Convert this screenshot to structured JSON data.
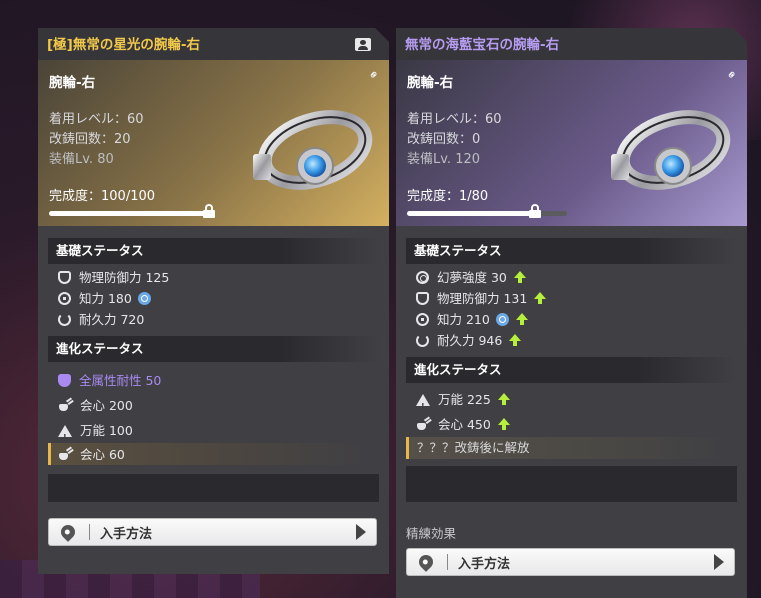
{
  "left_panel": {
    "title": "[極]無常の星光の腕輪-右",
    "slot": "腕輪-右",
    "meta": [
      "着用レベル：60",
      "改鋳回数：20",
      "装備Lv. 80"
    ],
    "completion": "完成度：100/100",
    "completion_fraction": 1.0,
    "base_header": "基礎ステータス",
    "base_stats": [
      {
        "icon": "shield-icon",
        "text": "物理防御力 125"
      },
      {
        "icon": "intellect-icon",
        "text": "知力 180"
      },
      {
        "icon": "durability-icon",
        "text": "耐久力 720"
      }
    ],
    "adv_header": "進化ステータス",
    "adv_stats": [
      {
        "icon": "resist-icon",
        "text": "全属性耐性 50"
      },
      {
        "icon": "crit-icon",
        "text": "会心 200"
      },
      {
        "icon": "versatility-icon",
        "text": "万能 100"
      },
      {
        "icon": "crit-icon",
        "text": "会心 60"
      }
    ],
    "acquire_label": "入手方法"
  },
  "right_panel": {
    "title": "無常の海藍宝石の腕輪-右",
    "slot": "腕輪-右",
    "meta": [
      "着用レベル：60",
      "改鋳回数：0",
      "装備Lv. 120"
    ],
    "completion": "完成度：1/80",
    "completion_fraction": 0.0125,
    "base_header": "基礎ステータス",
    "base_stats": [
      {
        "icon": "dream-icon",
        "text": "幻夢強度 30"
      },
      {
        "icon": "shield-icon",
        "text": "物理防御力 131"
      },
      {
        "icon": "intellect-icon",
        "text": "知力 210"
      },
      {
        "icon": "durability-icon",
        "text": "耐久力 946"
      }
    ],
    "adv_header": "進化ステータス",
    "adv_stats": [
      {
        "icon": "versatility-icon",
        "text": "万能 225"
      },
      {
        "icon": "crit-icon",
        "text": "会心 450"
      }
    ],
    "locked_text": "？？？改鋳後に解放",
    "refine_label": "精練効果",
    "acquire_label": "入手方法"
  },
  "colors": {
    "legendary_title": "#f2c94a",
    "epic_title": "#b69cf0",
    "upgrade_arrow": "#b6f03c",
    "resist_violet": "#a98af0"
  }
}
